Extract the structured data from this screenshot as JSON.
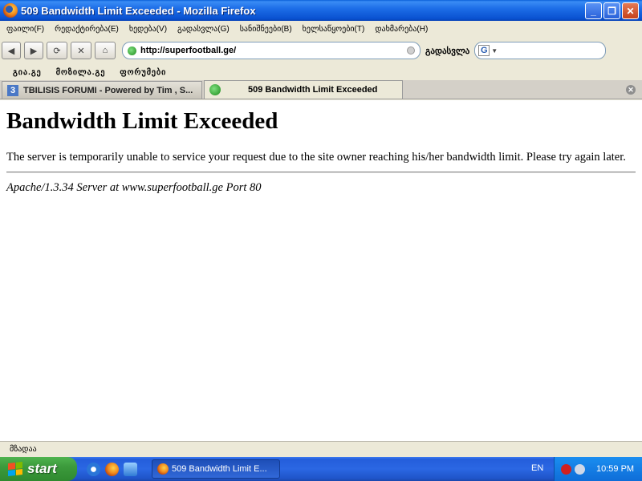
{
  "window": {
    "title": "509 Bandwidth Limit Exceeded - Mozilla Firefox",
    "minimize_label": "_",
    "maximize_label": "❐",
    "close_label": "✕"
  },
  "menu": {
    "items": [
      "ფაილი(F)",
      "რედაქტირება(E)",
      "ხედება(V)",
      "გადასვლა(G)",
      "სანიშნეები(B)",
      "ხელსაწყოები(T)",
      "დახმარება(H)"
    ]
  },
  "navigation": {
    "back": "◀",
    "forward": "▶",
    "reload": "⟳",
    "stop": "✕",
    "home": "⌂",
    "url": "http://superfootball.ge/",
    "go_label": "გადასვლა",
    "search_engine_letter": "G",
    "search_value": ""
  },
  "bookmarks": {
    "items": [
      "გია.გე",
      "მოზილა.გე",
      "ფორუმები"
    ]
  },
  "tabs": [
    {
      "label": "TBILISIS FORUMI - Powered by Tim , S...",
      "icon_letter": "3",
      "active": false
    },
    {
      "label": "509 Bandwidth Limit Exceeded",
      "active": true
    }
  ],
  "tab_close_label": "✕",
  "page": {
    "heading": "Bandwidth Limit Exceeded",
    "message": "The server is temporarily unable to service your request due to the site owner reaching his/her bandwidth limit. Please try again later.",
    "server_signature": "Apache/1.3.34 Server at www.superfootball.ge Port 80"
  },
  "status": {
    "text": "მზადაა"
  },
  "taskbar": {
    "start_label": "start",
    "task_label": "509 Bandwidth Limit E...",
    "language": "EN",
    "clock": "10:59 PM"
  }
}
